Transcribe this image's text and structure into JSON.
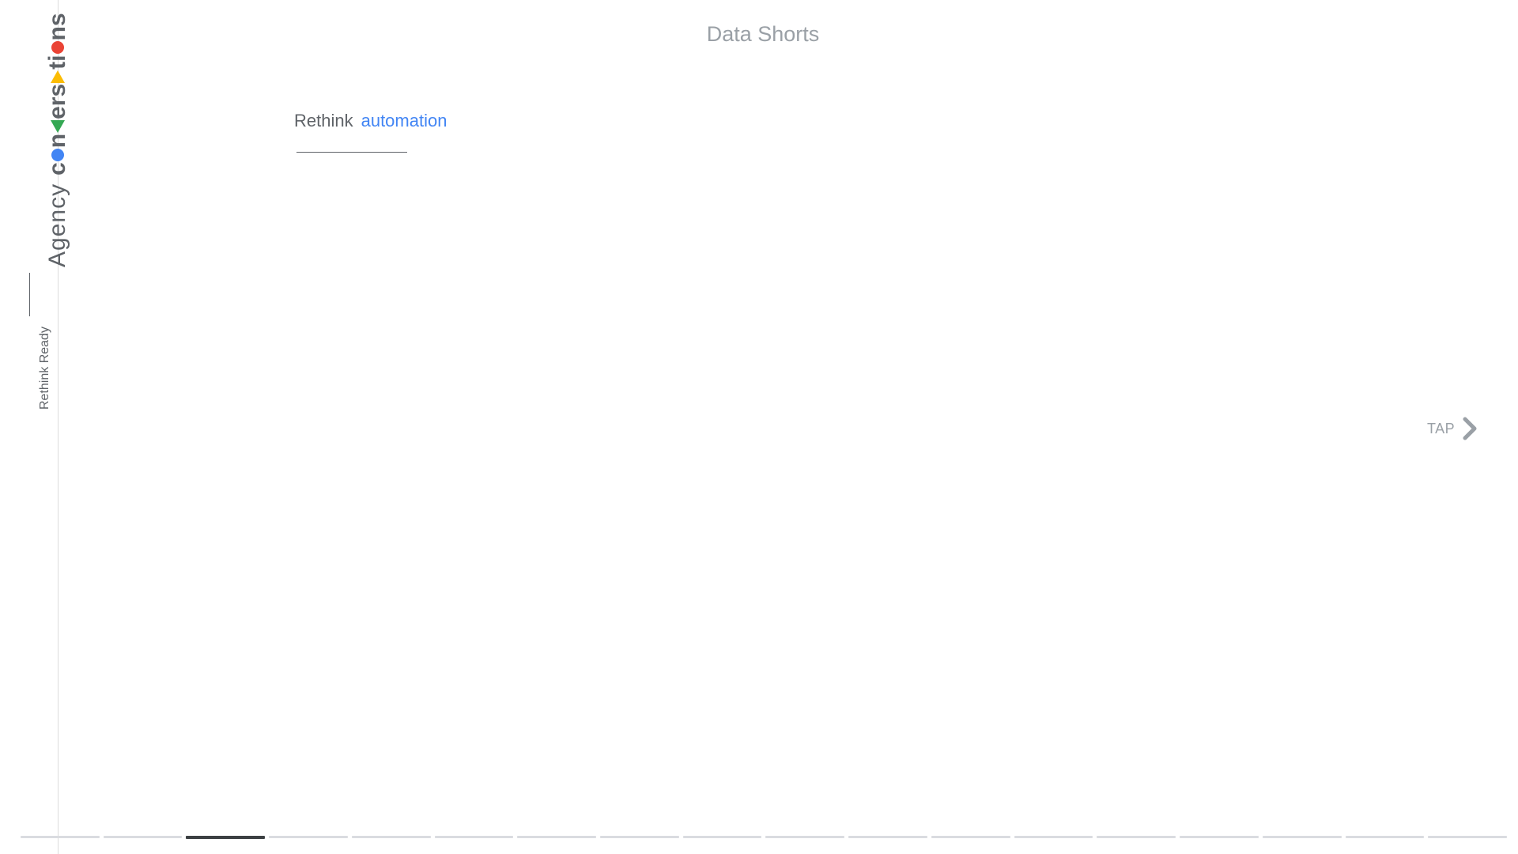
{
  "sidebar": {
    "brand_prefix": "Agency",
    "brand_word_chars": [
      "c",
      "o",
      "n",
      "v",
      "e",
      "r",
      "s",
      "a",
      "t",
      "i",
      "o",
      "n",
      "s"
    ],
    "tagline": "Rethink Ready"
  },
  "header": {
    "title": "Data Shorts"
  },
  "headline": {
    "part1": "Rethink",
    "part2": "automation"
  },
  "navigation": {
    "tap_label": "TAP",
    "icon": "chevron-right-icon"
  },
  "progress": {
    "total_segments": 18,
    "active_segment": 3
  },
  "colors": {
    "brand_blue": "#4285f4",
    "brand_green": "#34a853",
    "brand_yellow": "#fbbc04",
    "brand_red": "#ea4335",
    "text_gray": "#5f6368",
    "light_gray": "#9aa0a6"
  }
}
